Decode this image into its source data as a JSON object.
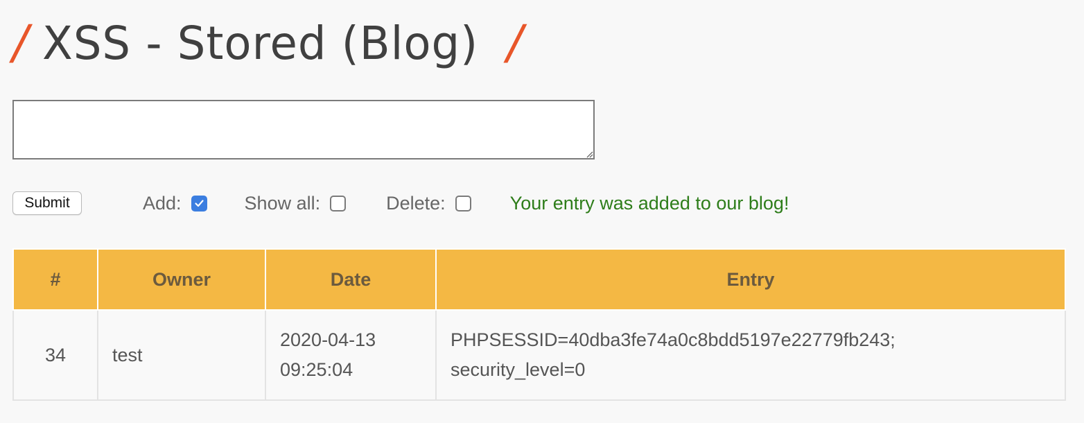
{
  "page": {
    "title": "XSS - Stored (Blog)",
    "title_decoration": "/"
  },
  "form": {
    "textarea_value": "",
    "submit_label": "Submit",
    "add_label": "Add:",
    "add_checked": true,
    "show_all_label": "Show all:",
    "show_all_checked": false,
    "delete_label": "Delete:",
    "delete_checked": false,
    "status_message": "Your entry was added to our blog!"
  },
  "table": {
    "headers": [
      "#",
      "Owner",
      "Date",
      "Entry"
    ],
    "rows": [
      {
        "id": "34",
        "owner": "test",
        "date_line1": "2020-04-13",
        "date_line2": "09:25:04",
        "entry_line1": "PHPSESSID=40dba3fe74a0c8bdd5197e22779fb243;",
        "entry_line2": "security_level=0"
      }
    ]
  },
  "colors": {
    "accent_slash": "#e8562a",
    "table_header_bg": "#f4b844",
    "success_text": "#2e7d1a",
    "checkbox_checked": "#3b7ee0"
  }
}
